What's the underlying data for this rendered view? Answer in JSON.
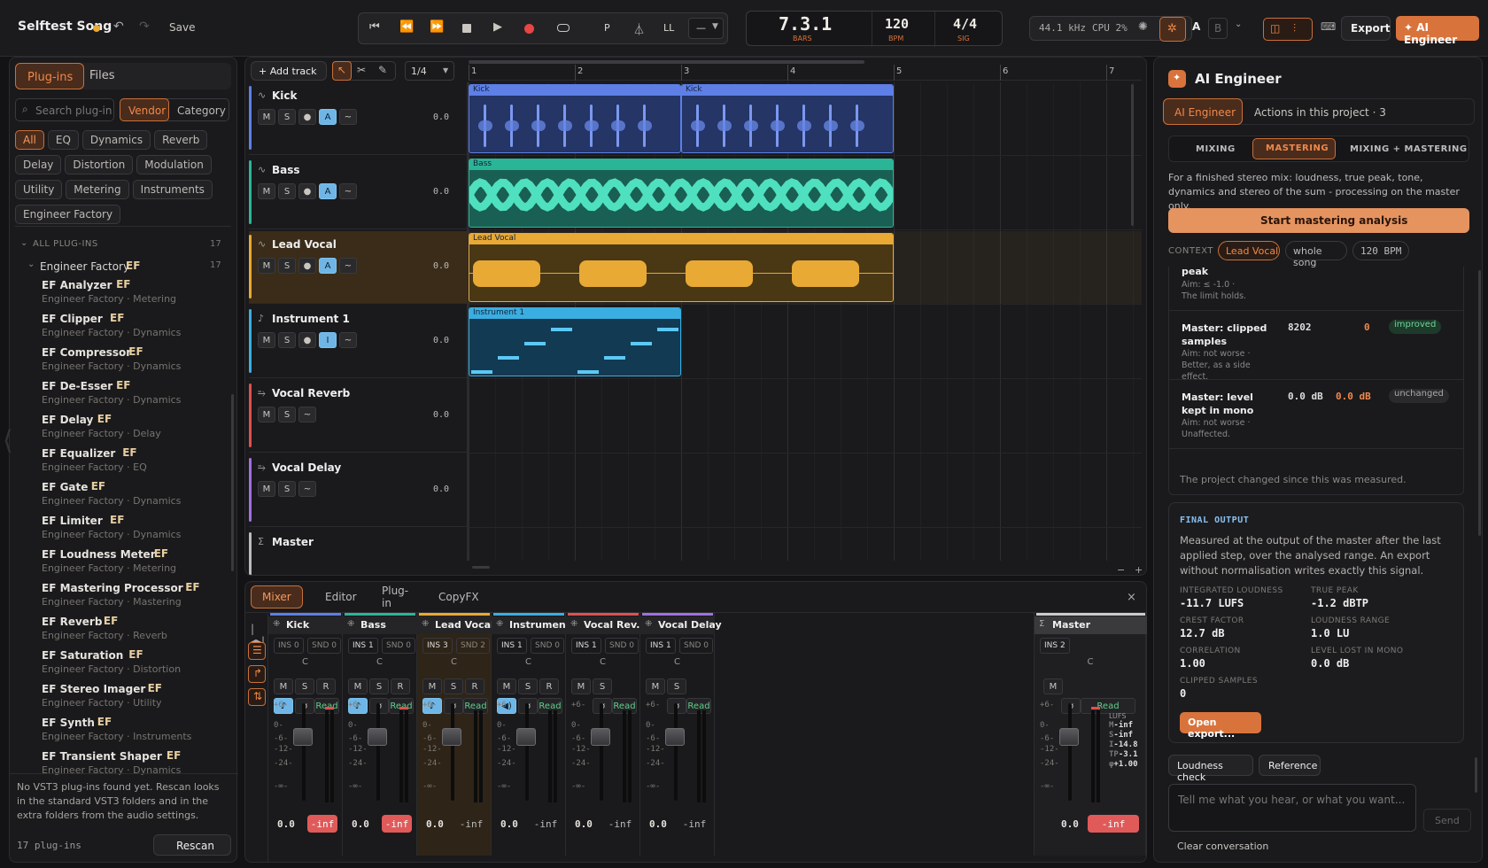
{
  "top": {
    "song": "Selftest Song",
    "save": "Save",
    "position": "7.3.1",
    "position_label": "BARS",
    "tempo": "120",
    "tempo_label": "BPM",
    "sig": "4/4",
    "sig_label": "SIG",
    "quant": "—",
    "rate": "44.1 kHz",
    "cpu": "CPU 2%",
    "ab_a": "A",
    "ab_b": "B",
    "export": "Export",
    "ai_engineer": "✦ AI Engineer",
    "p_label": "P",
    "ll_label": "LL"
  },
  "browser": {
    "tab_plugins": "Plug-ins",
    "tab_files": "Files",
    "search_placeholder": "Search plug-in",
    "sort_vendor": "Vendor",
    "sort_category": "Category",
    "filters": [
      "All",
      "EQ",
      "Dynamics",
      "Reverb",
      "Delay",
      "Distortion",
      "Modulation",
      "Utility",
      "Metering",
      "Instruments",
      "Engineer Factory"
    ],
    "all_label": "ALL PLUG-INS",
    "all_count": "17",
    "vendor_label": "Engineer Factory",
    "vendor_count": "17",
    "plugins": [
      {
        "name": "EF Analyzer",
        "sub": "Engineer Factory · Metering"
      },
      {
        "name": "EF Clipper",
        "sub": "Engineer Factory · Dynamics"
      },
      {
        "name": "EF Compressor",
        "sub": "Engineer Factory · Dynamics"
      },
      {
        "name": "EF De-Esser",
        "sub": "Engineer Factory · Dynamics"
      },
      {
        "name": "EF Delay",
        "sub": "Engineer Factory · Delay"
      },
      {
        "name": "EF Equalizer",
        "sub": "Engineer Factory · EQ"
      },
      {
        "name": "EF Gate",
        "sub": "Engineer Factory · Dynamics"
      },
      {
        "name": "EF Limiter",
        "sub": "Engineer Factory · Dynamics"
      },
      {
        "name": "EF Loudness Meter",
        "sub": "Engineer Factory · Metering"
      },
      {
        "name": "EF Mastering Processor",
        "sub": "Engineer Factory · Mastering"
      },
      {
        "name": "EF Reverb",
        "sub": "Engineer Factory · Reverb"
      },
      {
        "name": "EF Saturation",
        "sub": "Engineer Factory · Distortion"
      },
      {
        "name": "EF Stereo Imager",
        "sub": "Engineer Factory · Utility"
      },
      {
        "name": "EF Synth",
        "sub": "Engineer Factory · Instruments"
      },
      {
        "name": "EF Transient Shaper",
        "sub": "Engineer Factory · Dynamics"
      }
    ],
    "vst_note": "No VST3 plug-ins found yet. Rescan looks in the standard VST3 folders and in the extra folders from the audio settings.",
    "count": "17 plug-ins",
    "rescan": "Rescan"
  },
  "arrange": {
    "add_track": "+ Add track",
    "grid": "1/4",
    "bars": [
      "1",
      "2",
      "3",
      "4",
      "5",
      "6",
      "7"
    ],
    "tracks": [
      {
        "name": "Kick",
        "value": "0.0",
        "color": "#5d7fe6"
      },
      {
        "name": "Bass",
        "value": "0.0",
        "color": "#2bb597"
      },
      {
        "name": "Lead Vocal",
        "value": "0.0",
        "color": "#e8a935"
      },
      {
        "name": "Instrument 1",
        "value": "0.0",
        "color": "#3aaee0"
      },
      {
        "name": "Vocal Reverb",
        "value": "0.0",
        "color": "#e05050"
      },
      {
        "name": "Vocal Delay",
        "value": "0.0",
        "color": "#a070e0"
      },
      {
        "name": "Master",
        "value": "",
        "color": "#bbbbbb"
      }
    ],
    "clips": {
      "kick": "Kick",
      "bass": "Bass",
      "lead": "Lead Vocal",
      "inst": "Instrument 1"
    },
    "btn_m": "M",
    "btn_s": "S",
    "btn_dot": "●",
    "btn_a": "A",
    "btn_i": "I",
    "btn_wave": "~",
    "minus": "−",
    "plus": "+"
  },
  "mixer": {
    "tabs": [
      "Mixer",
      "Editor",
      "Plug-in",
      "CopyFX"
    ],
    "channels": [
      {
        "name": "Kick",
        "ins": "INS 0",
        "snd": "SND 0",
        "val": "0.0",
        "peak": "-inf",
        "color": "#5d7fe6",
        "clip": true
      },
      {
        "name": "Bass",
        "ins": "INS 1",
        "snd": "SND 0",
        "val": "0.0",
        "peak": "-inf",
        "color": "#2bb597",
        "clip": true
      },
      {
        "name": "Lead Vocal",
        "ins": "INS 3",
        "snd": "SND 2",
        "val": "0.0",
        "peak": "-inf",
        "color": "#e8a935",
        "clip": false
      },
      {
        "name": "Instrumen...",
        "ins": "INS 1",
        "snd": "SND 0",
        "val": "0.0",
        "peak": "-inf",
        "color": "#3aaee0",
        "clip": false
      },
      {
        "name": "Vocal Rev...",
        "ins": "INS 1",
        "snd": "SND 0",
        "val": "0.0",
        "peak": "-inf",
        "color": "#e05050",
        "clip": false
      },
      {
        "name": "Vocal Delay",
        "ins": "INS 1",
        "snd": "SND 0",
        "val": "0.0",
        "peak": "-inf",
        "color": "#a070e0",
        "clip": false
      }
    ],
    "master": {
      "name": "Master",
      "ins": "INS 2",
      "val": "0.0",
      "peak": "-inf"
    },
    "read": "Read",
    "phase": "ø",
    "pan": "C",
    "btn_m": "M",
    "btn_s": "S",
    "btn_r": "R",
    "scale": [
      "+6-",
      "0-",
      "-6-",
      "-12-",
      "-24-",
      "-∞-"
    ],
    "lufs_label": "LUFS",
    "lufs_rows": [
      {
        "k": "M",
        "v": "-inf"
      },
      {
        "k": "S",
        "v": "-inf"
      },
      {
        "k": "I",
        "v": "-14.8"
      },
      {
        "k": "TP",
        "v": "-3.1"
      },
      {
        "k": "φ",
        "v": "+1.00"
      }
    ],
    "close": "×"
  },
  "ai": {
    "title": "AI Engineer",
    "tab1": "AI Engineer",
    "tab2": "Actions in this project · 3",
    "modes": [
      "MIXING",
      "MASTERING",
      "MIXING + MASTERING"
    ],
    "desc": "For a finished stereo mix: loudness, true peak, tone, dynamics and stereo of the sum - processing on the master only.",
    "start": "Start mastering analysis",
    "context_label": "CONTEXT",
    "context": [
      "Lead Vocal",
      "whole song",
      "120 BPM"
    ],
    "results": [
      {
        "name": "peak",
        "aim": "Aim: ≤ -1.0 · The limit holds.",
        "before": "",
        "after": "",
        "status": ""
      },
      {
        "name": "Master: clipped samples",
        "aim": "Aim: not worse · Better, as a side effect.",
        "before": "8202",
        "after": "0",
        "status": "improved"
      },
      {
        "name": "Master: level kept in mono",
        "aim": "Aim: not worse · Unaffected.",
        "before": "0.0 dB",
        "after": "0.0 dB",
        "status": "unchanged"
      }
    ],
    "changed": "The project changed since this was measured.",
    "final_title": "FINAL OUTPUT",
    "final_desc": "Measured at the output of the master after the last applied step, over the analysed range. An export without normalisation writes exactly this signal.",
    "metrics": [
      {
        "k": "INTEGRATED LOUDNESS",
        "v": "-11.7 LUFS"
      },
      {
        "k": "TRUE PEAK",
        "v": "-1.2 dBTP"
      },
      {
        "k": "CREST FACTOR",
        "v": "12.7 dB"
      },
      {
        "k": "LOUDNESS RANGE",
        "v": "1.0 LU"
      },
      {
        "k": "CORRELATION",
        "v": "1.00"
      },
      {
        "k": "LEVEL LOST IN MONO",
        "v": "0.0 dB"
      },
      {
        "k": "CLIPPED SAMPLES",
        "v": "0"
      }
    ],
    "open_export": "Open export...",
    "loudness_check": "Loudness check",
    "reference": "Reference",
    "chat_placeholder": "Tell me what you hear, or what you want...",
    "send": "Send",
    "clear": "Clear conversation"
  },
  "colors": {
    "accent": "#d9733c",
    "kick": "#5d7fe6",
    "bass": "#2bb597",
    "lead": "#e8a935",
    "inst": "#3aaee0"
  }
}
